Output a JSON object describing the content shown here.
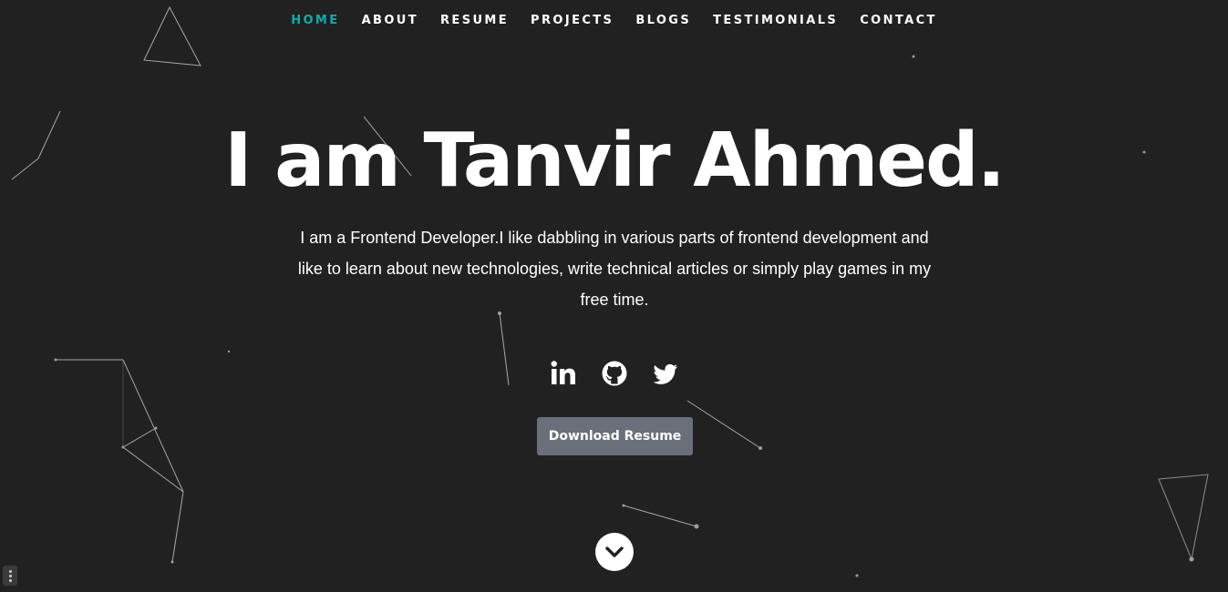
{
  "nav": {
    "items": [
      {
        "label": "HOME",
        "active": true
      },
      {
        "label": "ABOUT",
        "active": false
      },
      {
        "label": "RESUME",
        "active": false
      },
      {
        "label": "PROJECTS",
        "active": false
      },
      {
        "label": "BLOGS",
        "active": false
      },
      {
        "label": "TESTIMONIALS",
        "active": false
      },
      {
        "label": "CONTACT",
        "active": false
      }
    ]
  },
  "hero": {
    "title": "I am Tanvir Ahmed.",
    "description": "I am a Frontend Developer.I like dabbling in various parts of frontend development and like to learn about new technologies, write technical articles or simply play games in my free time."
  },
  "social": {
    "icons": [
      "linkedin-icon",
      "github-icon",
      "twitter-icon"
    ]
  },
  "actions": {
    "download_resume_label": "Download Resume"
  },
  "icons": {
    "scroll_down": "chevron-down-icon"
  },
  "colors": {
    "background": "#212121",
    "accent": "#11abb0",
    "button": "#6a7079",
    "text": "#ffffff"
  }
}
